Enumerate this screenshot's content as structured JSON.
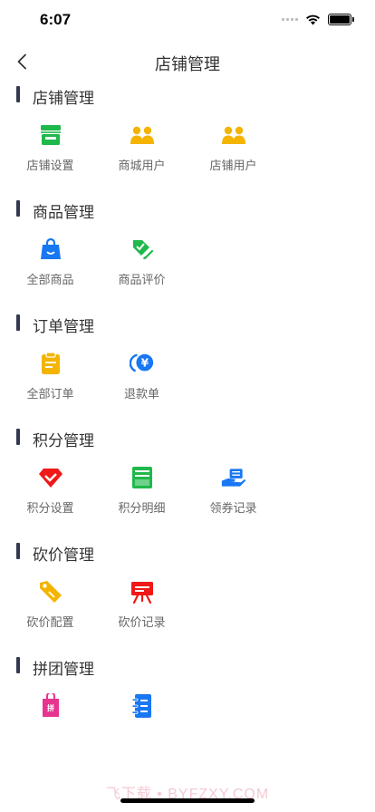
{
  "status_bar": {
    "time": "6:07"
  },
  "nav": {
    "title": "店铺管理"
  },
  "sections": [
    {
      "title": "店铺管理",
      "items": [
        {
          "label": "店铺设置",
          "icon": "store-icon",
          "color": "#1fb84a"
        },
        {
          "label": "商城用户",
          "icon": "users-icon",
          "color": "#f4b400"
        },
        {
          "label": "店铺用户",
          "icon": "users-icon",
          "color": "#f4b400"
        }
      ]
    },
    {
      "title": "商品管理",
      "items": [
        {
          "label": "全部商品",
          "icon": "shopping-bag-icon",
          "color": "#1877f2"
        },
        {
          "label": "商品评价",
          "icon": "review-tag-icon",
          "color": "#1fb84a"
        }
      ]
    },
    {
      "title": "订单管理",
      "items": [
        {
          "label": "全部订单",
          "icon": "clipboard-icon",
          "color": "#f4b400"
        },
        {
          "label": "退款单",
          "icon": "refund-icon",
          "color": "#1877f2"
        }
      ]
    },
    {
      "title": "积分管理",
      "items": [
        {
          "label": "积分设置",
          "icon": "diamond-icon",
          "color": "#f01818"
        },
        {
          "label": "积分明细",
          "icon": "ledger-icon",
          "color": "#1fb84a"
        },
        {
          "label": "领券记录",
          "icon": "coupon-hand-icon",
          "color": "#1877f2"
        }
      ]
    },
    {
      "title": "砍价管理",
      "items": [
        {
          "label": "砍价配置",
          "icon": "price-tag-icon",
          "color": "#f4b400"
        },
        {
          "label": "砍价记录",
          "icon": "board-icon",
          "color": "#f01818"
        }
      ]
    },
    {
      "title": "拼团管理",
      "items": [
        {
          "label": "",
          "icon": "group-tag-icon",
          "color": "#e6348f"
        },
        {
          "label": "",
          "icon": "notebook-icon",
          "color": "#1877f2"
        }
      ]
    }
  ],
  "watermark": "飞下载 • BYFZXY.COM"
}
